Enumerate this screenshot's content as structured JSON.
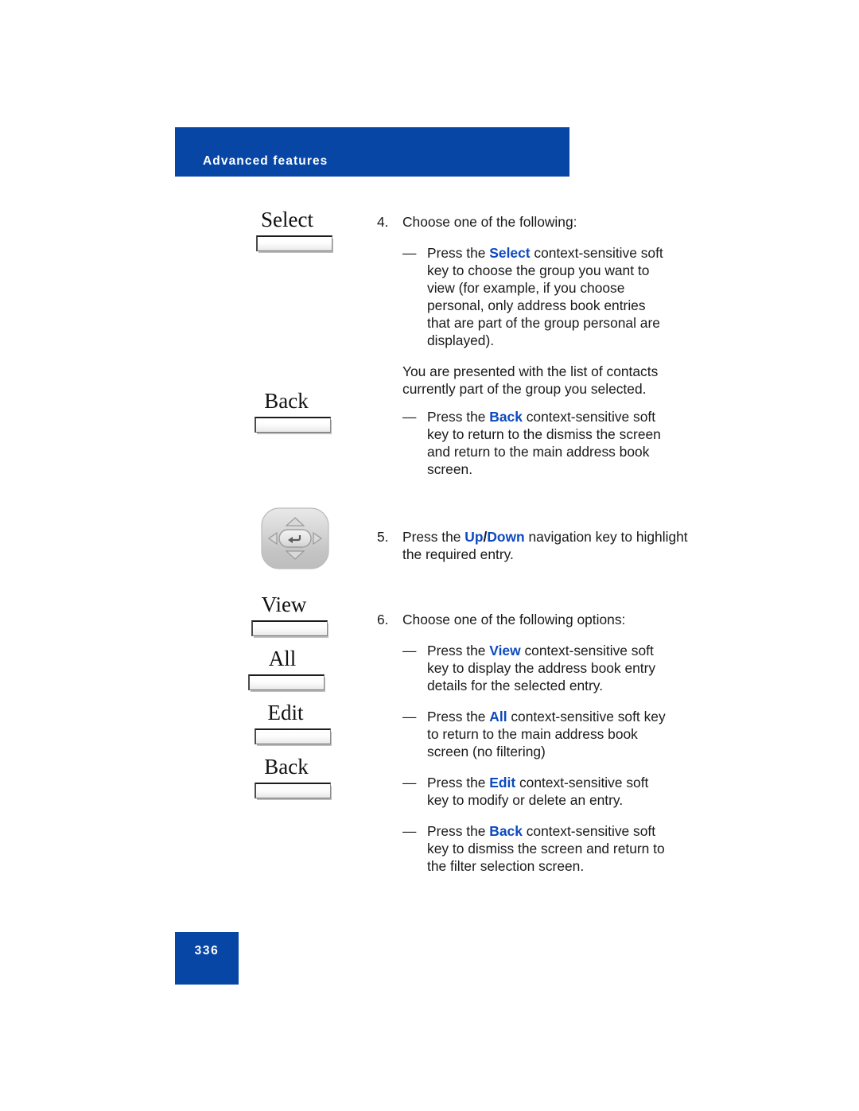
{
  "header": {
    "title": "Advanced features"
  },
  "page_number": "336",
  "softkeys": [
    {
      "label": "Select",
      "icon": "softkey-button"
    },
    {
      "label": "Back",
      "icon": "softkey-button"
    },
    {
      "label": "View",
      "icon": "softkey-button"
    },
    {
      "label": "All",
      "icon": "softkey-button"
    },
    {
      "label": "Edit",
      "icon": "softkey-button"
    },
    {
      "label": "Back",
      "icon": "softkey-button"
    }
  ],
  "navpad": {
    "icon": "navigation-key-cluster",
    "up_arrow": "up-arrow-icon",
    "down_arrow": "down-arrow-icon",
    "left_arrow": "left-arrow-icon",
    "right_arrow": "right-arrow-icon",
    "center": "enter-key-icon"
  },
  "steps": {
    "step4": {
      "number": "4.",
      "text": "Choose one of the following:",
      "bullet1": {
        "dash": "—",
        "pre": "Press the ",
        "keyword": "Select",
        "post": " context-sensitive soft key to choose the group you want to view (for example, if you choose personal, only address book entries that are part of the group personal are displayed)."
      },
      "note": "You are presented with the list of contacts currently part of the group you selected.",
      "bullet2": {
        "dash": "—",
        "pre": "Press the ",
        "keyword": "Back",
        "post": " context-sensitive soft key to return to the dismiss the screen and return to the main address book screen."
      }
    },
    "step5": {
      "number": "5.",
      "pre": "Press the ",
      "keyword1": "Up",
      "separator": "/",
      "keyword2": "Down",
      "post": " navigation key to highlight the required entry."
    },
    "step6": {
      "number": "6.",
      "text": "Choose one of the following options:",
      "bullet1": {
        "dash": "—",
        "pre": "Press the ",
        "keyword": "View",
        "post": " context-sensitive soft key to display the address book entry details for the selected entry."
      },
      "bullet2": {
        "dash": "—",
        "pre": "Press the ",
        "keyword": "All",
        "post": " context-sensitive soft key to return to the main address book screen (no filtering)"
      },
      "bullet3": {
        "dash": "—",
        "pre": "Press the ",
        "keyword": "Edit",
        "post": " context-sensitive soft key to modify or delete an entry."
      },
      "bullet4": {
        "dash": "—",
        "pre": "Press the ",
        "keyword": "Back",
        "post": " context-sensitive soft key to dismiss the screen and return to the filter selection screen."
      }
    }
  },
  "colors": {
    "header_blue": "#0846a6",
    "keyword_blue": "#0d49bf",
    "body_text": "#1a1a1a"
  }
}
